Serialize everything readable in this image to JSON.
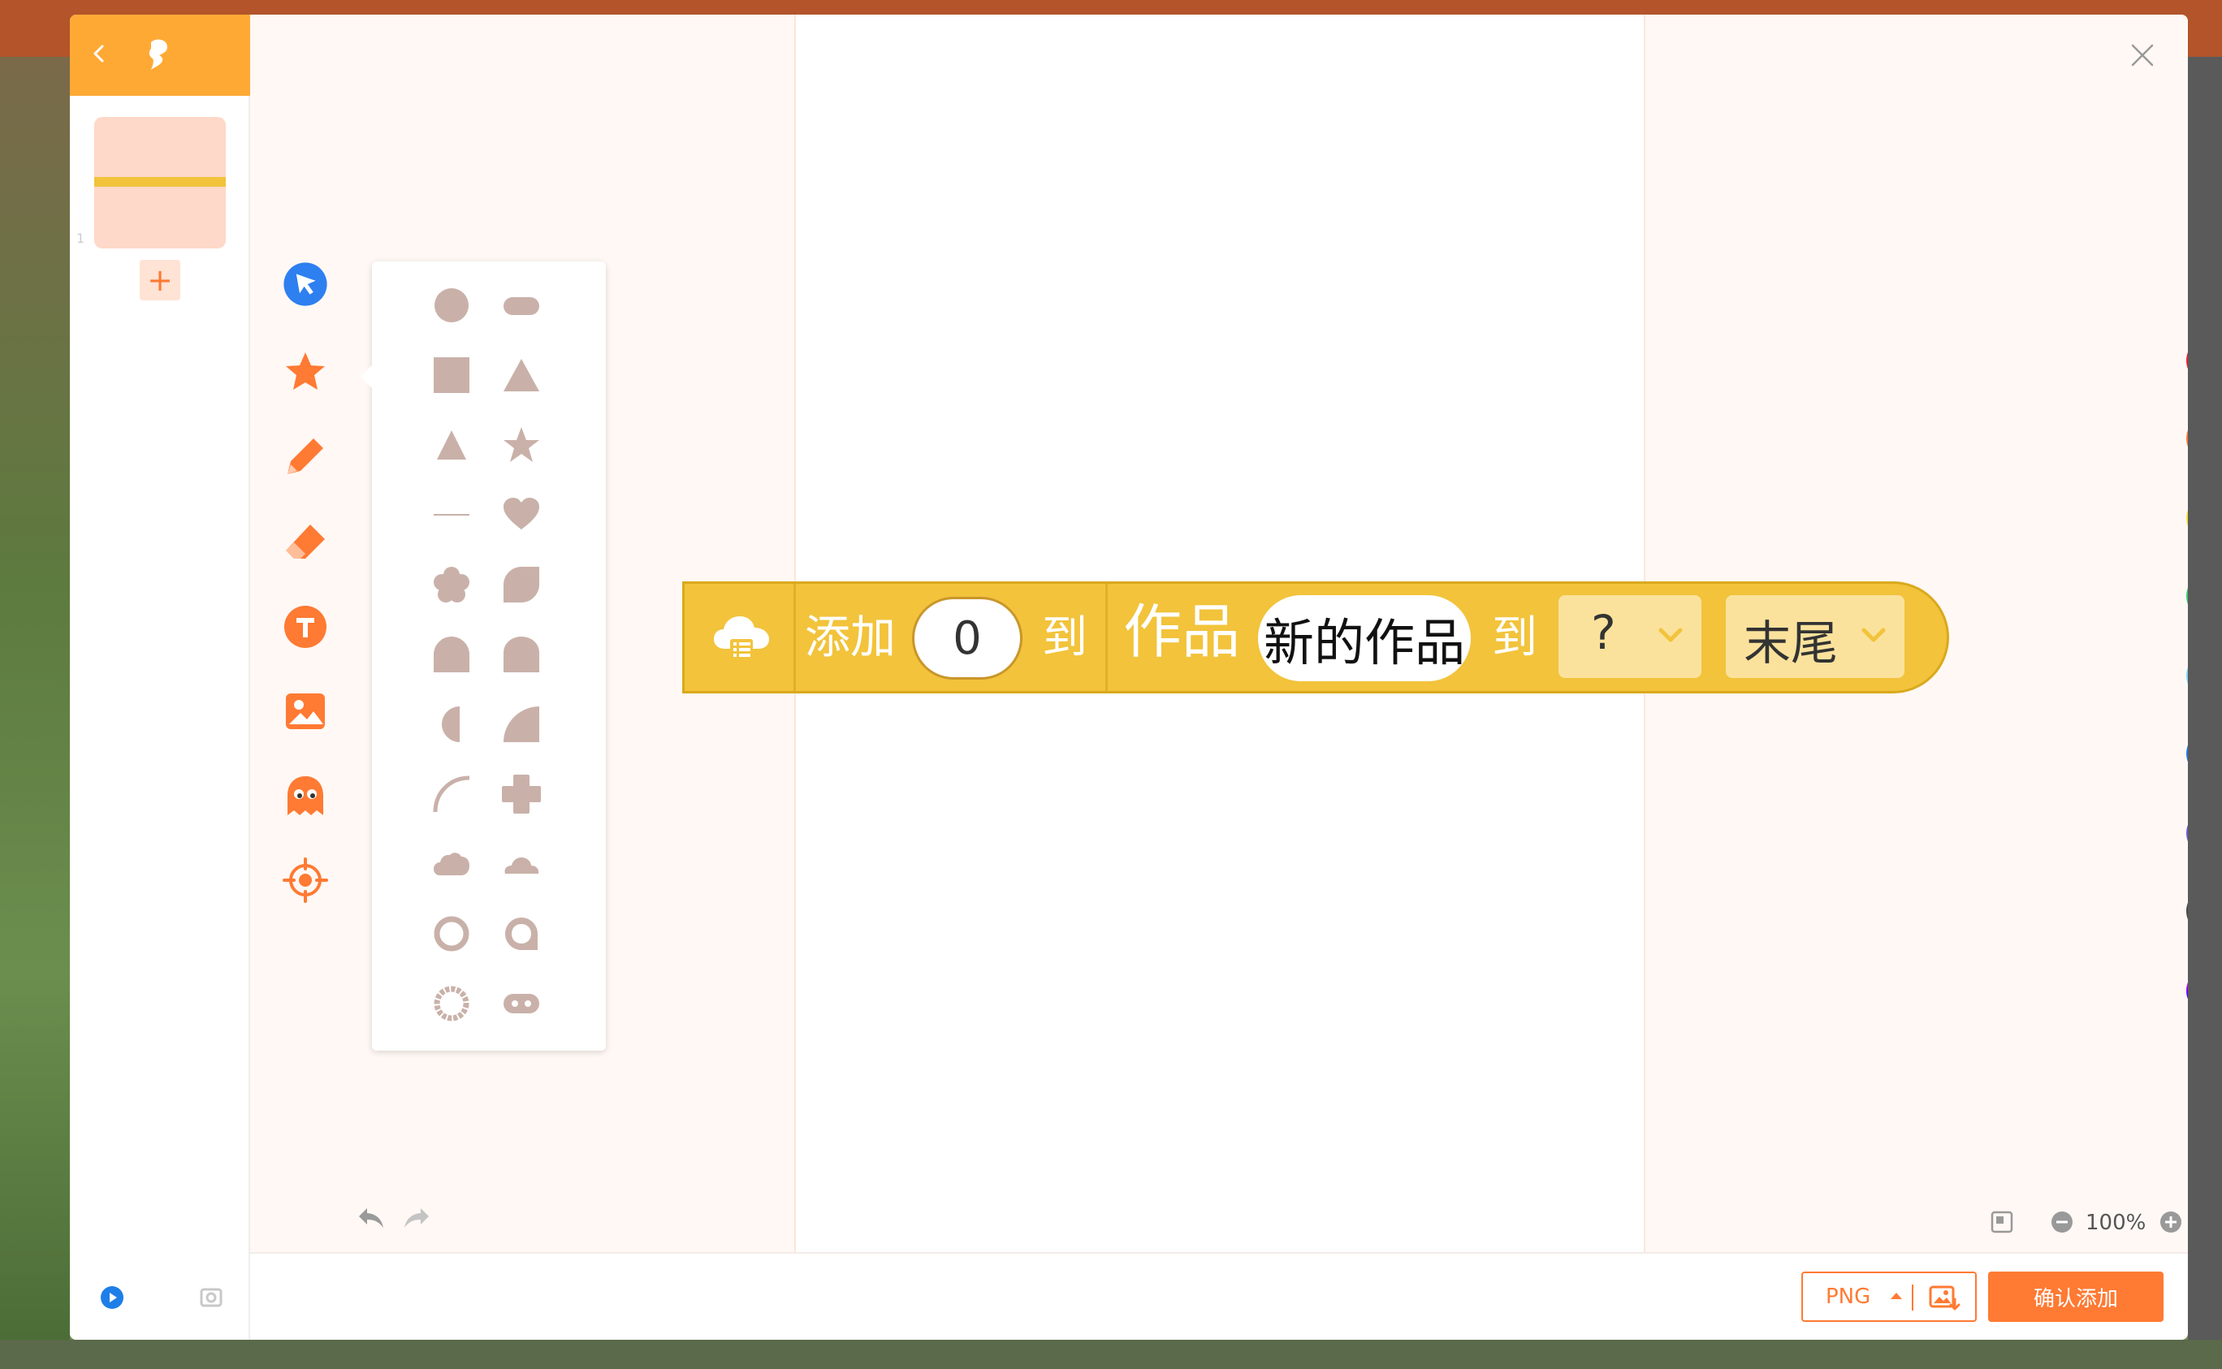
{
  "code_block": {
    "add_label": "添加",
    "number_value": "0",
    "to_label_1": "到",
    "work_label": "作品",
    "work_name": "新的作品",
    "to_label_2": "到",
    "position_value": "?",
    "end_value": "末尾"
  },
  "page_thumb": {
    "page_number": "1",
    "add_symbol": "+"
  },
  "zoom": {
    "level": "100%"
  },
  "export": {
    "format": "PNG",
    "confirm_label": "确认添加"
  },
  "colors": {
    "palette": [
      "#e6212d",
      "#ff7a33",
      "#f8e13e",
      "#35cf6c",
      "#7dd3f8",
      "#1e7ee8",
      "#6e5bd6"
    ],
    "more": "#474747",
    "accent": "#ff7a33",
    "header": "#ffa935",
    "block_yellow": "#f2c33b",
    "shape_fill": "#c9b1a9"
  },
  "tools": [
    "select-tool",
    "shape-tool",
    "pencil-tool",
    "eraser-tool",
    "text-tool",
    "image-tool",
    "character-tool",
    "target-tool"
  ]
}
